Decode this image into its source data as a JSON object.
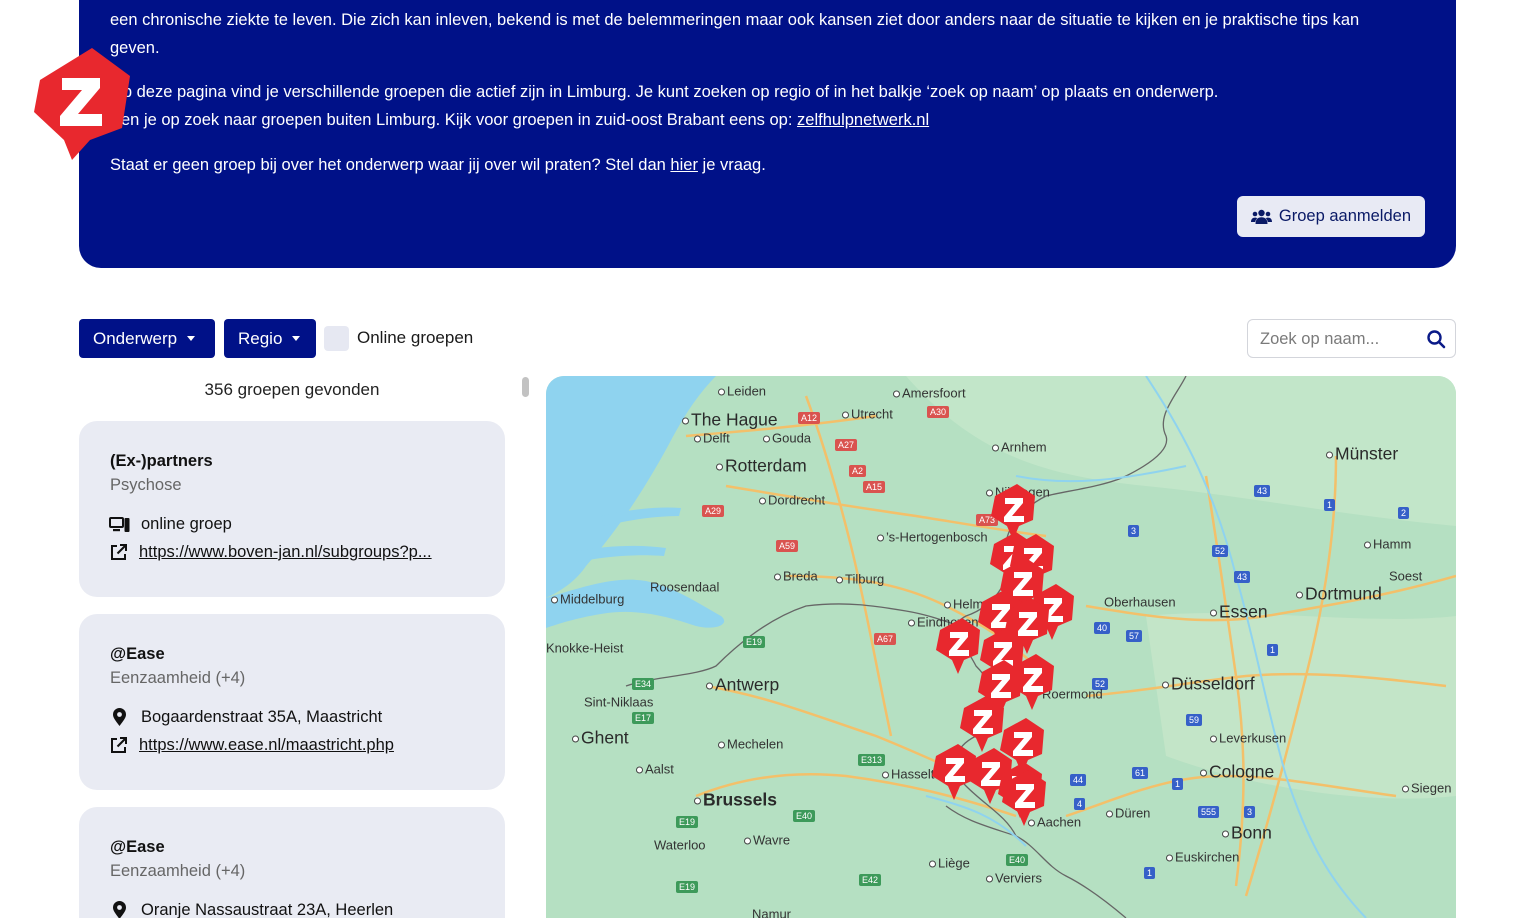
{
  "banner": {
    "line1": "een chronische ziekte te leven. Die zich kan inleven, bekend is met de belemmeringen maar ook kansen ziet door anders naar de situatie te kijken en je praktische tips kan",
    "line2": "geven.",
    "line3": "Op deze pagina vind je verschillende groepen die actief zijn in Limburg. Je kunt zoeken op regio of in het balkje ‘zoek op naam’ op plaats en onderwerp.",
    "line4_prefix": "Ben je op zoek naar groepen buiten Limburg. Kijk voor groepen in zuid-oost Brabant eens op:",
    "line4_link": "zelfhulpnetwerk.nl",
    "line5_prefix": "Staat er geen groep bij over het onderwerp waar jij over wil praten? Stel dan",
    "line5_link": "hier",
    "line5_suffix": "je vraag.",
    "button_label": "Groep aanmelden",
    "background": "#001188"
  },
  "logo": {
    "letter": "Z",
    "color": "#e8282e"
  },
  "filters": {
    "onderwerp_label": "Onderwerp",
    "regio_label": "Regio",
    "online_label": "Online groepen",
    "online_checked": false,
    "search_placeholder": "Zoek op naam..."
  },
  "results": {
    "count_text": "356 groepen gevonden",
    "cards": [
      {
        "title": "(Ex-)partners",
        "subtitle": "Psychose",
        "row1_icon": "computer-icon",
        "row1_text": "online groep",
        "row2_icon": "external-link-icon",
        "row2_text": "https://www.boven-jan.nl/subgroups?p..."
      },
      {
        "title": "@Ease",
        "subtitle": "Eenzaamheid (+4)",
        "row1_icon": "location-pin-icon",
        "row1_text": "Bogaardenstraat 35A, Maastricht",
        "row2_icon": "external-link-icon",
        "row2_text": "https://www.ease.nl/maastricht.php"
      },
      {
        "title": "@Ease",
        "subtitle": "Eenzaamheid (+4)",
        "row1_icon": "location-pin-icon",
        "row1_text": "Oranje Nassaustraat 23A, Heerlen",
        "row2_icon": "external-link-icon",
        "row2_text": ""
      }
    ]
  },
  "map": {
    "cities": [
      {
        "name": "Leiden",
        "size": "small"
      },
      {
        "name": "Amersfoort",
        "size": "small"
      },
      {
        "name": "The Hague",
        "size": "big"
      },
      {
        "name": "Utrecht",
        "size": "small"
      },
      {
        "name": "Delft",
        "size": "small"
      },
      {
        "name": "Gouda",
        "size": "small"
      },
      {
        "name": "Arnhem",
        "size": "small"
      },
      {
        "name": "Rotterdam",
        "size": "big"
      },
      {
        "name": "Münster",
        "size": "big"
      },
      {
        "name": "Dordrecht",
        "size": "small"
      },
      {
        "name": "Nijmegen",
        "size": "small"
      },
      {
        "name": "’s-Hertogenbosch",
        "size": "small"
      },
      {
        "name": "Hamm",
        "size": "small"
      },
      {
        "name": "Breda",
        "size": "small"
      },
      {
        "name": "Tilburg",
        "size": "small"
      },
      {
        "name": "Roosendaal",
        "size": "small"
      },
      {
        "name": "Soest",
        "size": "small"
      },
      {
        "name": "Middelburg",
        "size": "small"
      },
      {
        "name": "Dortmund",
        "size": "big"
      },
      {
        "name": "Oberhausen",
        "size": "small"
      },
      {
        "name": "Essen",
        "size": "big"
      },
      {
        "name": "Helmond",
        "size": "small"
      },
      {
        "name": "Eindhoven",
        "size": "small"
      },
      {
        "name": "Knokke-Heist",
        "size": "small"
      },
      {
        "name": "Antwerp",
        "size": "big"
      },
      {
        "name": "Roermond",
        "size": "small"
      },
      {
        "name": "Düsseldorf",
        "size": "big"
      },
      {
        "name": "Sint-Niklaas",
        "size": "small"
      },
      {
        "name": "Ghent",
        "size": "big"
      },
      {
        "name": "Mechelen",
        "size": "small"
      },
      {
        "name": "Leverkusen",
        "size": "small"
      },
      {
        "name": "Aalst",
        "size": "small"
      },
      {
        "name": "Hasselt",
        "size": "small"
      },
      {
        "name": "Cologne",
        "size": "big"
      },
      {
        "name": "Brussels",
        "size": "big"
      },
      {
        "name": "Siegen",
        "size": "small"
      },
      {
        "name": "Düren",
        "size": "small"
      },
      {
        "name": "Aachen",
        "size": "small"
      },
      {
        "name": "Bonn",
        "size": "big"
      },
      {
        "name": "Waterloo",
        "size": "small"
      },
      {
        "name": "Wavre",
        "size": "small"
      },
      {
        "name": "Euskirchen",
        "size": "small"
      },
      {
        "name": "Liège",
        "size": "small"
      },
      {
        "name": "Verviers",
        "size": "small"
      },
      {
        "name": "Namur",
        "size": "small"
      }
    ],
    "marker_letter": "Z",
    "marker_color": "#e8282e"
  }
}
